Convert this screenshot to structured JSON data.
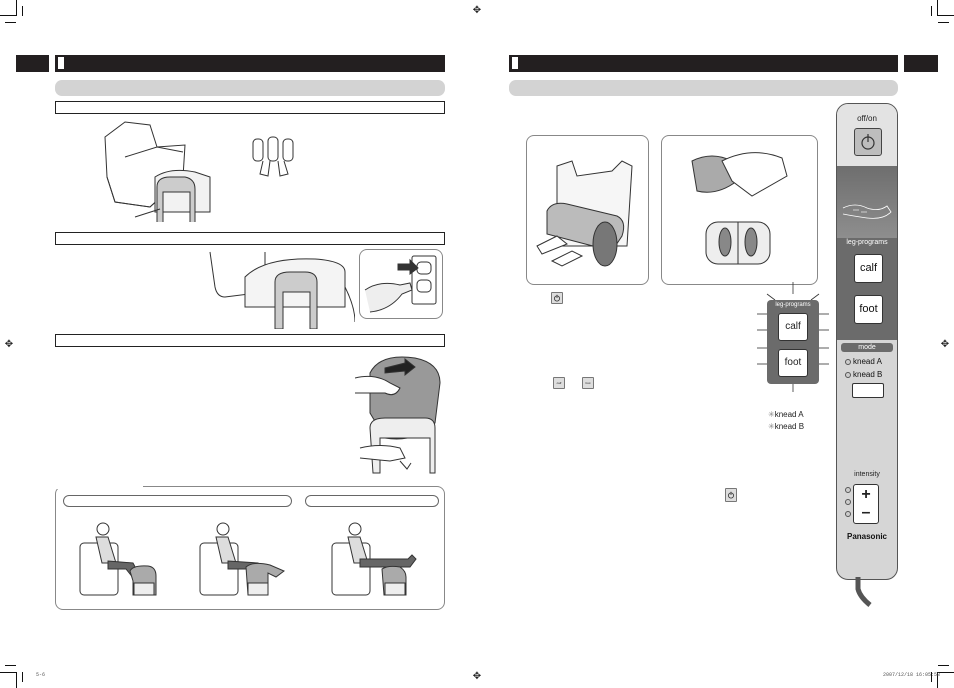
{
  "document": {
    "type": "instruction manual spread",
    "left_page": {
      "header_bar_label": "",
      "section_bar_label": "",
      "subsections": [
        "",
        "",
        ""
      ],
      "illustrations": [
        "armchair-with-leg-massager",
        "leg-massager-front-view",
        "massager-cable-to-wall-outlet",
        "tilting-massager-by-hand",
        "usage-posture-1",
        "usage-posture-2",
        "usage-posture-3"
      ],
      "posture_box": {
        "pill_labels": [
          "",
          ""
        ]
      },
      "footer": {
        "page_code": "5-6"
      }
    },
    "right_page": {
      "header_bar_label": "",
      "section_bar_label": "",
      "illustrations": [
        "calf-massage-in-chair",
        "foot-massage-close-up"
      ],
      "inline_buttons": {
        "power": "power-icon",
        "calf": "calf",
        "foot": "foot"
      },
      "leg_programs_diagram": {
        "title": "leg-programs",
        "buttons": [
          "calf",
          "foot"
        ],
        "mode_indicators": [
          "knead A",
          "knead B"
        ]
      },
      "footer": {
        "timestamp": "2007/12/18   16:05:58"
      }
    }
  },
  "remote": {
    "power_label": "off/on",
    "leg_programs_label": "leg-programs",
    "calf_label": "calf",
    "foot_label": "foot",
    "mode_label": "mode",
    "knead_a": "knead A",
    "knead_b": "knead B",
    "intensity_label": "intensity",
    "plus": "+",
    "minus": "–",
    "brand": "Panasonic"
  },
  "colors": {
    "header_bar": "#231f20",
    "section_bar": "#d3d3d3",
    "remote_body": "#d6d6d6",
    "remote_dark": "#6b6b6b"
  }
}
